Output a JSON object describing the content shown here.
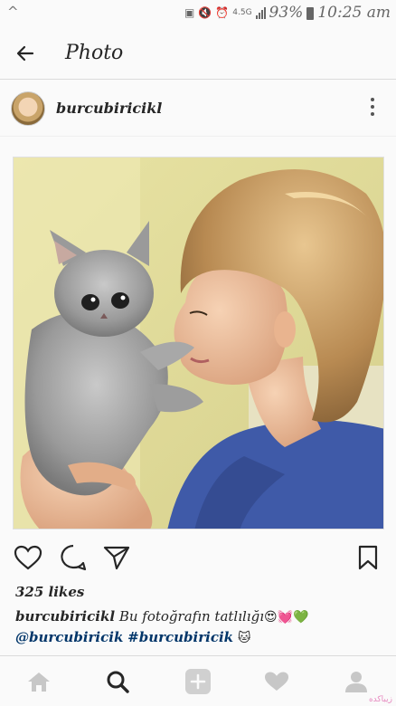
{
  "status_bar": {
    "left_icon": "^",
    "network": "4.5G",
    "battery_percent": "93%",
    "time": "10:25 am",
    "icons": [
      "photo-icon",
      "mute-icon",
      "alarm-icon",
      "signal-icon",
      "battery-icon"
    ]
  },
  "header": {
    "back_icon": "arrow-left-icon",
    "title": "Photo"
  },
  "post": {
    "username": "burcubiricikl",
    "more_icon": "vertical-dots-icon",
    "likes": "325 likes",
    "caption": {
      "username": "burcubiricikl",
      "text": "Bu fotoğrafın tatlılığı",
      "emojis": "😍💓💚",
      "mention": "@burcubiricik",
      "hashtag": "#burcubiricik",
      "end_emoji": "🐱"
    },
    "actions": [
      "heart-icon",
      "comment-icon",
      "share-icon",
      "bookmark-icon"
    ]
  },
  "bottom_nav": {
    "items": [
      "home-icon",
      "search-icon",
      "add-post-icon",
      "activity-heart-icon",
      "profile-icon"
    ],
    "active": "search-icon"
  },
  "watermark": "زیباکده"
}
